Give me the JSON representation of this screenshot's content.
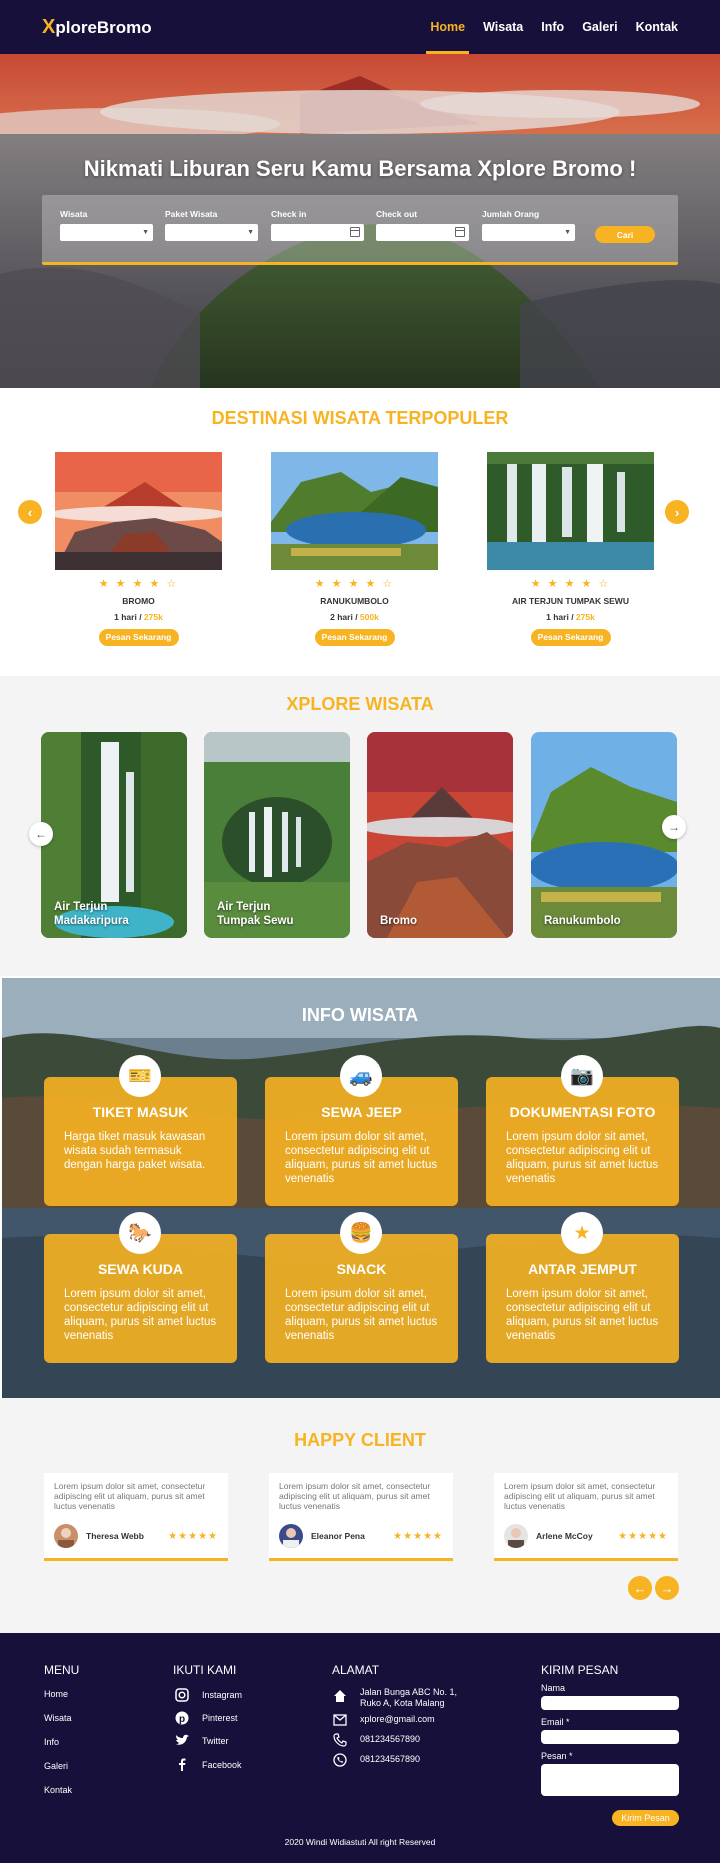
{
  "navbar": {
    "logo_x": "X",
    "logo_rest": "ploreBromo",
    "items": [
      "Home",
      "Wisata",
      "Info",
      "Galeri",
      "Kontak"
    ],
    "active": "Home"
  },
  "hero": {
    "title": "Nikmati Liburan Seru Kamu Bersama Xplore Bromo !",
    "fields": {
      "wisata": "Wisata",
      "paket": "Paket Wisata",
      "checkin": "Check in",
      "checkout": "Check out",
      "jumlah": "Jumlah Orang"
    },
    "search_button": "Cari"
  },
  "destinasi": {
    "title": "DESTINASI WISATA TERPOPULER",
    "cards": [
      {
        "name": "BROMO",
        "duration": "1 hari / ",
        "price": "275k",
        "stars": "★ ★ ★ ★ ☆",
        "rating": 4,
        "button": "Pesan Sekarang"
      },
      {
        "name": "RANUKUMBOLO",
        "duration": "2 hari / ",
        "price": "500k",
        "stars": "★ ★ ★ ★ ☆",
        "rating": 4,
        "button": "Pesan Sekarang"
      },
      {
        "name": "AIR TERJUN  TUMPAK SEWU",
        "duration": "1 hari / ",
        "price": "275k",
        "stars": "★ ★ ★ ★ ☆",
        "rating": 4,
        "button": "Pesan Sekarang"
      }
    ]
  },
  "xplore": {
    "title": "XPLORE WISATA",
    "cards": [
      {
        "line1": "Air Terjun",
        "line2": "Madakaripura"
      },
      {
        "line1": "Air Terjun",
        "line2": "Tumpak Sewu"
      },
      {
        "line1": "Bromo",
        "line2": ""
      },
      {
        "line1": "Ranukumbolo",
        "line2": ""
      }
    ]
  },
  "info": {
    "title": "INFO WISATA",
    "cards": [
      {
        "title": "TIKET MASUK",
        "text": "Harga tiket masuk kawasan wisata sudah termasuk dengan harga paket wisata.",
        "icon": "ticket-icon"
      },
      {
        "title": "SEWA JEEP",
        "text": "Lorem ipsum dolor sit amet, consectetur adipiscing elit ut aliquam, purus sit amet luctus venenatis",
        "icon": "jeep-icon"
      },
      {
        "title": "DOKUMENTASI FOTO",
        "text": "Lorem ipsum dolor sit amet, consectetur adipiscing elit ut aliquam, purus sit amet luctus venenatis",
        "icon": "camera-icon"
      },
      {
        "title": "SEWA KUDA",
        "text": "Lorem ipsum dolor sit amet, consectetur adipiscing elit ut aliquam, purus sit amet luctus venenatis",
        "icon": "horse-icon"
      },
      {
        "title": "SNACK",
        "text": "Lorem ipsum dolor sit amet, consectetur adipiscing elit ut aliquam, purus sit amet luctus venenatis",
        "icon": "snack-icon"
      },
      {
        "title": "ANTAR JEMPUT",
        "text": "Lorem ipsum dolor sit amet, consectetur adipiscing elit ut aliquam, purus sit amet luctus venenatis",
        "icon": "star-icon"
      }
    ]
  },
  "happy": {
    "title": "HAPPY CLIENT",
    "testimonials": [
      {
        "text": "Lorem ipsum dolor sit amet, consectetur adipiscing elit ut aliquam, purus sit amet luctus venenatis",
        "name": "Theresa Webb",
        "stars": "★★★★★",
        "rating": 4.5
      },
      {
        "text": "Lorem ipsum dolor sit amet, consectetur adipiscing elit ut aliquam, purus sit amet luctus venenatis",
        "name": "Eleanor Pena",
        "stars": "★★★★★",
        "rating": 4.5
      },
      {
        "text": "Lorem ipsum dolor sit amet, consectetur adipiscing elit ut aliquam, purus sit amet luctus venenatis",
        "name": "Arlene McCoy",
        "stars": "★★★★★",
        "rating": 4.5
      }
    ]
  },
  "footer": {
    "menu_title": "MENU",
    "menu": [
      "Home",
      "Wisata",
      "Info",
      "Galeri",
      "Kontak"
    ],
    "social_title": "IKUTI KAMI",
    "social": [
      "Instagram",
      "Pinterest",
      "Twitter",
      "Facebook"
    ],
    "address_title": "ALAMAT",
    "address_line1": "Jalan Bunga ABC No. 1,",
    "address_line2": "Ruko A, Kota Malang",
    "email": "xplore@gmail.com",
    "phone": "081234567890",
    "whatsapp": "081234567890",
    "contact_title": "KIRIM PESAN",
    "name_label": "Nama",
    "email_label": "Email *",
    "message_label": "Pesan *",
    "send_button": "Kirim Pesan",
    "copyright": "2020 Windi Widiastuti All right Reserved"
  },
  "colors": {
    "accent": "#f7b322",
    "navy": "#16103a"
  }
}
